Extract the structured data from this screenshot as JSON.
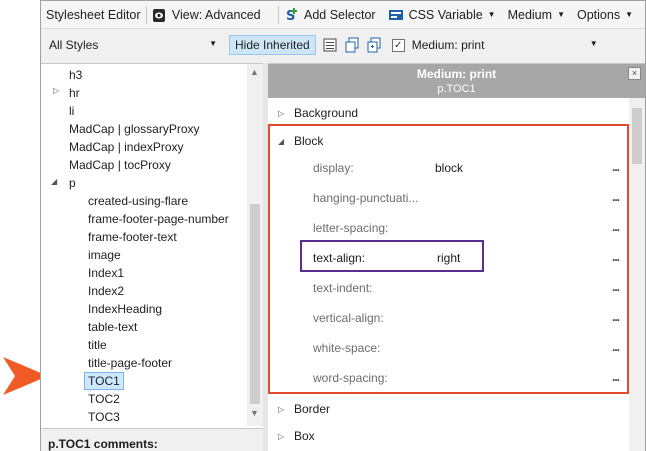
{
  "colors": {
    "callout_arrow": "#f15a24",
    "block_highlight": "#e04a2f",
    "row_highlight": "#5a2d91",
    "header_bg": "#a7a7a7",
    "selection": "#cce8ff"
  },
  "toolbar": {
    "title": "Stylesheet Editor",
    "view_label": "View: Advanced",
    "view_icon": "eye-icon",
    "add_selector_label": "Add Selector",
    "add_selector_icon": "add-selector-icon",
    "css_variable_label": "CSS Variable",
    "css_variable_icon": "css-variable-icon",
    "medium_label": "Medium",
    "options_label": "Options"
  },
  "filter": {
    "styles_value": "All Styles",
    "hide_inherited_label": "Hide Inherited",
    "medium_value": "Medium: print"
  },
  "tree": {
    "items": [
      {
        "label": "h3",
        "level": 0
      },
      {
        "label": "hr",
        "level": 0,
        "expand": "collapsed"
      },
      {
        "label": "li",
        "level": 0
      },
      {
        "label": "MadCap | glossaryProxy",
        "level": 0
      },
      {
        "label": "MadCap | indexProxy",
        "level": 0
      },
      {
        "label": "MadCap | tocProxy",
        "level": 0
      },
      {
        "label": "p",
        "level": 0,
        "expand": "expanded"
      },
      {
        "label": "created-using-flare",
        "level": 1
      },
      {
        "label": "frame-footer-page-number",
        "level": 1
      },
      {
        "label": "frame-footer-text",
        "level": 1
      },
      {
        "label": "image",
        "level": 1
      },
      {
        "label": "Index1",
        "level": 1
      },
      {
        "label": "Index2",
        "level": 1
      },
      {
        "label": "IndexHeading",
        "level": 1
      },
      {
        "label": "table-text",
        "level": 1
      },
      {
        "label": "title",
        "level": 1
      },
      {
        "label": "title-page-footer",
        "level": 1
      },
      {
        "label": "TOC1",
        "level": 1,
        "selected": true
      },
      {
        "label": "TOC2",
        "level": 1
      },
      {
        "label": "TOC3",
        "level": 1
      }
    ],
    "comments_label": "p.TOC1 comments:"
  },
  "properties": {
    "header_medium": "Medium: print",
    "header_selector": "p.TOC1",
    "sections": [
      {
        "name": "Background",
        "expanded": false
      },
      {
        "name": "Block",
        "expanded": true
      },
      {
        "name": "Border",
        "expanded": false
      },
      {
        "name": "Box",
        "expanded": false
      }
    ],
    "block_props": [
      {
        "name": "display:",
        "value": "block",
        "set": false
      },
      {
        "name": "hanging-punctuati...",
        "value": "",
        "set": false
      },
      {
        "name": "letter-spacing:",
        "value": "",
        "set": false
      },
      {
        "name": "text-align:",
        "value": "right",
        "set": true
      },
      {
        "name": "text-indent:",
        "value": "",
        "set": false
      },
      {
        "name": "vertical-align:",
        "value": "",
        "set": false
      },
      {
        "name": "white-space:",
        "value": "",
        "set": false
      },
      {
        "name": "word-spacing:",
        "value": "",
        "set": false
      }
    ],
    "ellipsis": "..."
  }
}
